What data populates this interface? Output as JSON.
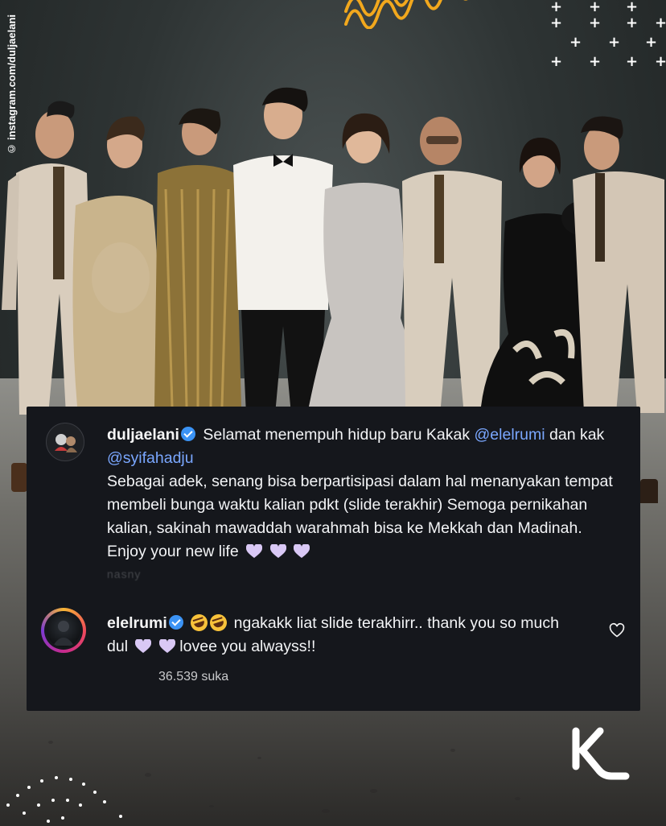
{
  "credit": "© instagram.com/duljaelani",
  "colors": {
    "card_bg": "#15171c",
    "mention": "#7aa7ff",
    "verified": "#3b93f5",
    "wave_accent": "#f2a81d"
  },
  "comments": [
    {
      "username": "duljaelani",
      "verified": true,
      "avatar_icon": "profile-avatar-icon",
      "segments": {
        "text1": "Selamat menempuh hidup baru Kakak",
        "mention1": "@elelrumi",
        "text2": "dan kak",
        "mention2": "@syifahadju",
        "text3": "Sebagai adek, senang bisa berpartisipasi dalam hal menanyakan tempat membeli bunga waktu kalian pdkt (slide terakhir) Semoga pernikahan kalian, sakinah mawaddah warahmah bisa ke Mekkah dan Madinah. Enjoy your new life"
      },
      "faded_meta": "nasny"
    },
    {
      "username": "elelrumi",
      "verified": true,
      "avatar_icon": "story-ring-avatar-icon",
      "text": "ngakakk liat slide terakhirr.. thank you so much dul",
      "text_end": "lovee you alwayss!!",
      "likes": "36.539 suka",
      "like_button_icon": "heart-outline-icon"
    }
  ],
  "logo": "KL"
}
